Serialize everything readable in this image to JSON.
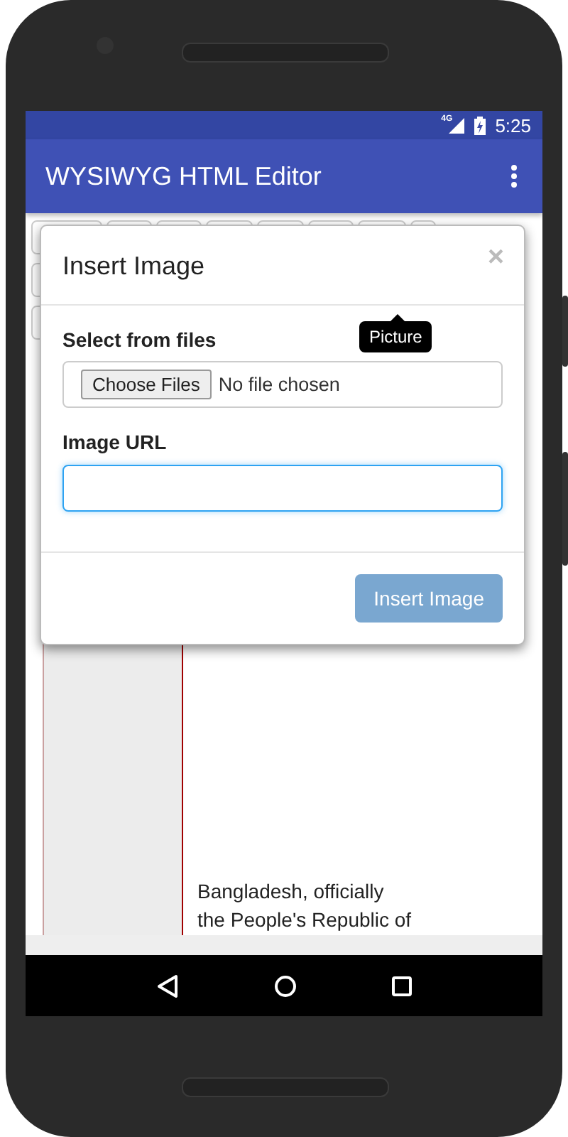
{
  "status_bar": {
    "network": "4G",
    "time": "5:25"
  },
  "app_bar": {
    "title": "WYSIWYG HTML Editor"
  },
  "toolbar_rows": [
    [
      {
        "kind": "button"
      },
      {
        "kind": "button"
      },
      {
        "kind": "button"
      },
      {
        "kind": "button"
      },
      {
        "kind": "button"
      },
      {
        "kind": "button"
      },
      {
        "kind": "button"
      },
      {
        "kind": "button"
      }
    ],
    [
      {
        "kind": "button"
      }
    ],
    [
      {
        "kind": "button"
      }
    ]
  ],
  "editor": {
    "lines": [
      "Bangladesh, officially",
      "the People's Republic of"
    ]
  },
  "dialog": {
    "title": "Insert Image",
    "close": "×",
    "file_label": "Select from files",
    "file_button": "Choose Files",
    "file_status": "No file chosen",
    "url_label": "Image URL",
    "url_focused": true,
    "submit": {
      "label": "Insert Image",
      "disabled": true
    },
    "tooltip": "Picture"
  }
}
